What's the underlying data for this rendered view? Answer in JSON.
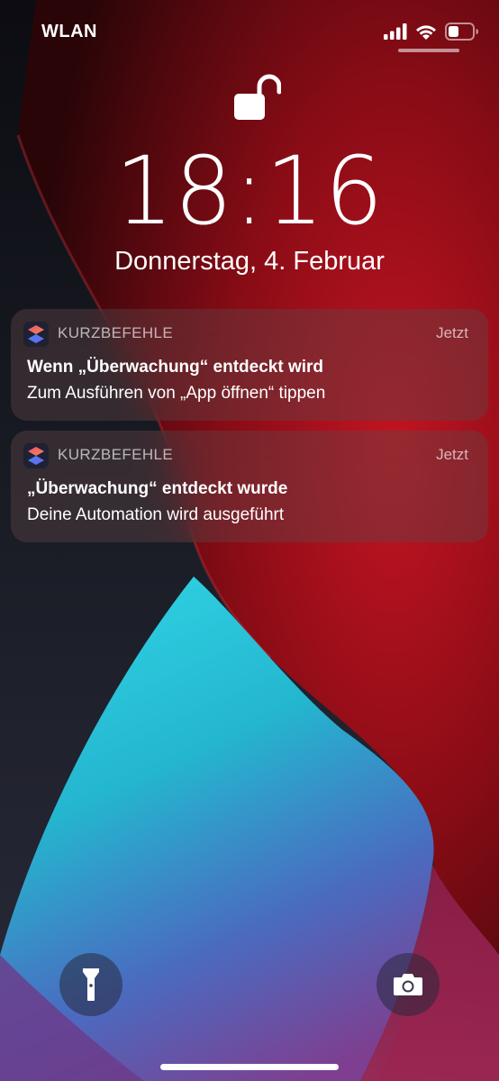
{
  "status_bar": {
    "carrier": "WLAN",
    "icons": [
      "cellular-signal-icon",
      "wifi-icon",
      "battery-icon"
    ]
  },
  "lock_screen": {
    "lock_icon": "unlocked-padlock-icon",
    "time": "18:16",
    "date": "Donnerstag, 4. Februar"
  },
  "notifications": [
    {
      "app_icon": "shortcuts-app-icon",
      "app_name": "KURZBEFEHLE",
      "time": "Jetzt",
      "title": "Wenn „Überwachung“ entdeckt wird",
      "body": "Zum Ausführen von „App öffnen“ tippen"
    },
    {
      "app_icon": "shortcuts-app-icon",
      "app_name": "KURZBEFEHLE",
      "time": "Jetzt",
      "title": "„Überwachung“ entdeckt wurde",
      "body": "Deine Automation wird ausgeführt"
    }
  ],
  "quick_actions": {
    "left_icon": "flashlight-icon",
    "right_icon": "camera-icon"
  },
  "colors": {
    "wallpaper_red": "#b0141e",
    "wallpaper_cyan": "#2ac4d8",
    "wallpaper_purple": "#7a3a8c",
    "wallpaper_dark": "#15151f"
  }
}
